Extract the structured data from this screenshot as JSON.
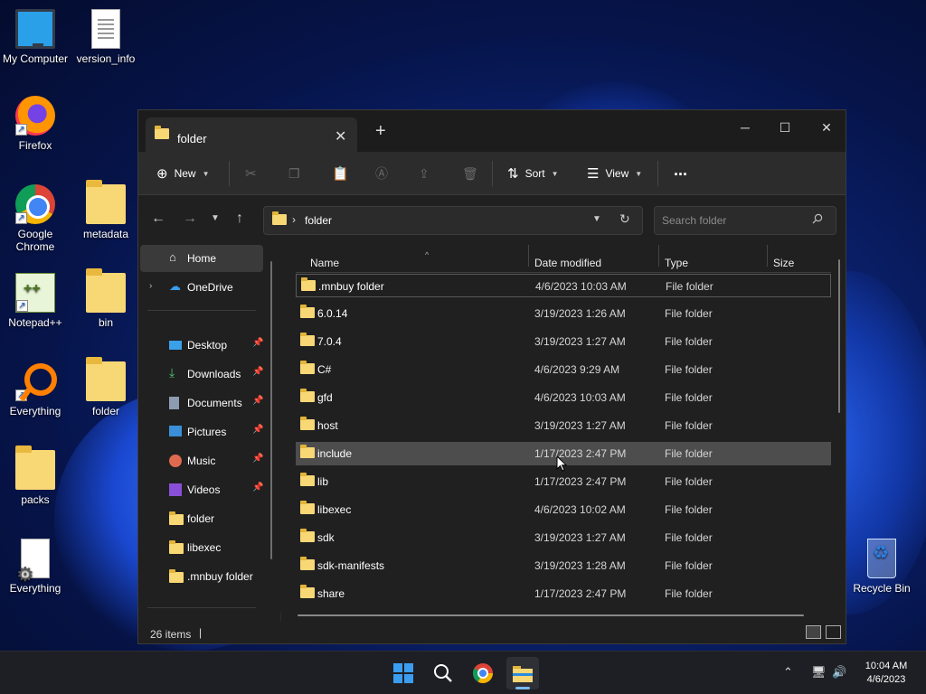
{
  "desktop": {
    "icons": [
      {
        "label": "My Computer",
        "icon": "computer-icon"
      },
      {
        "label": "version_info",
        "icon": "text-file-icon"
      },
      {
        "label": "Firefox",
        "icon": "firefox-icon"
      },
      {
        "label": "Google Chrome",
        "icon": "chrome-icon"
      },
      {
        "label": "metadata",
        "icon": "folder-icon"
      },
      {
        "label": "Notepad++",
        "icon": "notepadpp-icon"
      },
      {
        "label": "bin",
        "icon": "folder-icon"
      },
      {
        "label": "Everything",
        "icon": "everything-search-icon"
      },
      {
        "label": "folder",
        "icon": "folder-icon"
      },
      {
        "label": "packs",
        "icon": "folder-icon"
      },
      {
        "label": "Everything",
        "icon": "settings-file-icon"
      },
      {
        "label": "Recycle Bin",
        "icon": "recycle-bin-icon"
      }
    ]
  },
  "explorer": {
    "tab_title": "folder",
    "toolbar": {
      "new_label": "New",
      "sort_label": "Sort",
      "view_label": "View",
      "more_label": "..."
    },
    "address": {
      "path": "folder"
    },
    "search": {
      "placeholder": "Search folder"
    },
    "sidebar": {
      "items": [
        {
          "label": "Home",
          "icon": "home-icon",
          "pinned": false
        },
        {
          "label": "OneDrive",
          "icon": "cloud-icon",
          "pinned": false
        },
        {
          "label": "Desktop",
          "icon": "desktop-icon",
          "pinned": true
        },
        {
          "label": "Downloads",
          "icon": "download-icon",
          "pinned": true
        },
        {
          "label": "Documents",
          "icon": "document-icon",
          "pinned": true
        },
        {
          "label": "Pictures",
          "icon": "picture-icon",
          "pinned": true
        },
        {
          "label": "Music",
          "icon": "music-icon",
          "pinned": true
        },
        {
          "label": "Videos",
          "icon": "video-icon",
          "pinned": true
        },
        {
          "label": "folder",
          "icon": "folder-icon",
          "pinned": false
        },
        {
          "label": "libexec",
          "icon": "folder-icon",
          "pinned": false
        },
        {
          "label": ".mnbuy folder",
          "icon": "folder-icon",
          "pinned": false
        }
      ]
    },
    "columns": {
      "name": "Name",
      "date": "Date modified",
      "type": "Type",
      "size": "Size"
    },
    "rows": [
      {
        "name": ".mnbuy folder",
        "date": "4/6/2023 10:03 AM",
        "type": "File folder"
      },
      {
        "name": "6.0.14",
        "date": "3/19/2023 1:26 AM",
        "type": "File folder"
      },
      {
        "name": "7.0.4",
        "date": "3/19/2023 1:27 AM",
        "type": "File folder"
      },
      {
        "name": "C#",
        "date": "4/6/2023 9:29 AM",
        "type": "File folder"
      },
      {
        "name": "gfd",
        "date": "4/6/2023 10:03 AM",
        "type": "File folder"
      },
      {
        "name": "host",
        "date": "3/19/2023 1:27 AM",
        "type": "File folder"
      },
      {
        "name": "include",
        "date": "1/17/2023 2:47 PM",
        "type": "File folder"
      },
      {
        "name": "lib",
        "date": "1/17/2023 2:47 PM",
        "type": "File folder"
      },
      {
        "name": "libexec",
        "date": "4/6/2023 10:02 AM",
        "type": "File folder"
      },
      {
        "name": "sdk",
        "date": "3/19/2023 1:27 AM",
        "type": "File folder"
      },
      {
        "name": "sdk-manifests",
        "date": "3/19/2023 1:28 AM",
        "type": "File folder"
      },
      {
        "name": "share",
        "date": "1/17/2023 2:47 PM",
        "type": "File folder"
      }
    ],
    "status": {
      "item_count": "26 items",
      "separator": "|"
    }
  },
  "taskbar": {
    "apps": [
      "start-icon",
      "search-icon",
      "chrome-icon",
      "file-explorer-icon"
    ],
    "clock": {
      "time": "10:04 AM",
      "date": "4/6/2023"
    }
  },
  "colors": {
    "window_bg": "#202020",
    "toolbar_bg": "#2c2c2c",
    "selection": "#4d4d4d",
    "folder_yellow": "#f8d775",
    "taskbar_bg": "#1e1f24"
  }
}
